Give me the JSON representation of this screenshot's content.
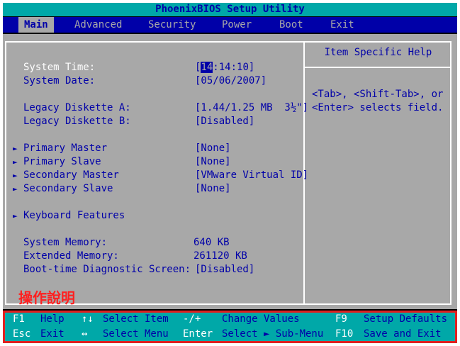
{
  "title": "PhoenixBIOS Setup Utility",
  "menu": [
    {
      "label": "Main",
      "active": true
    },
    {
      "label": "Advanced"
    },
    {
      "label": "Security"
    },
    {
      "label": "Power"
    },
    {
      "label": "Boot"
    },
    {
      "label": "Exit"
    }
  ],
  "fields": {
    "system_time": {
      "label": "System Time:",
      "value_hour": "14",
      "value_rest": ":14:10]",
      "value_open": "["
    },
    "system_date": {
      "label": "System Date:",
      "value": "[05/06/2007]"
    },
    "legacy_a": {
      "label": "Legacy Diskette A:",
      "value": "[1.44/1.25 MB  3½\"]"
    },
    "legacy_b": {
      "label": "Legacy Diskette B:",
      "value": "[Disabled]"
    },
    "primary_master": {
      "label": "Primary Master",
      "value": "[None]"
    },
    "primary_slave": {
      "label": "Primary Slave",
      "value": "[None]"
    },
    "secondary_master": {
      "label": "Secondary Master",
      "value": "[VMware Virtual ID]"
    },
    "secondary_slave": {
      "label": "Secondary Slave",
      "value": "[None]"
    },
    "keyboard_features": {
      "label": "Keyboard Features"
    },
    "system_memory": {
      "label": "System Memory:",
      "value": "640 KB"
    },
    "extended_memory": {
      "label": "Extended Memory:",
      "value": "261120 KB"
    },
    "boot_diag": {
      "label": "Boot-time Diagnostic Screen:",
      "value": "[Disabled]"
    }
  },
  "help": {
    "title": "Item Specific Help",
    "text": "<Tab>, <Shift-Tab>, or\n<Enter> selects field."
  },
  "annotation": "操作說明",
  "footer": {
    "f1_key": "F1",
    "f1_desc": "Help",
    "updown_key": "↑↓",
    "updown_desc": "Select Item",
    "pm_key": "-/+",
    "pm_desc": "Change Values",
    "f9_key": "F9",
    "f9_desc": "Setup Defaults",
    "esc_key": "Esc",
    "esc_desc": "Exit",
    "lr_key": "↔",
    "lr_desc": "Select Menu",
    "enter_key": "Enter",
    "enter_desc": "Select ► Sub-Menu",
    "f10_key": "F10",
    "f10_desc": "Save and Exit"
  },
  "colors": {
    "bios_blue": "#0000a8",
    "bios_cyan": "#00a8a8",
    "bios_gray": "#a8a8a8",
    "annotation_red": "#e02020"
  }
}
